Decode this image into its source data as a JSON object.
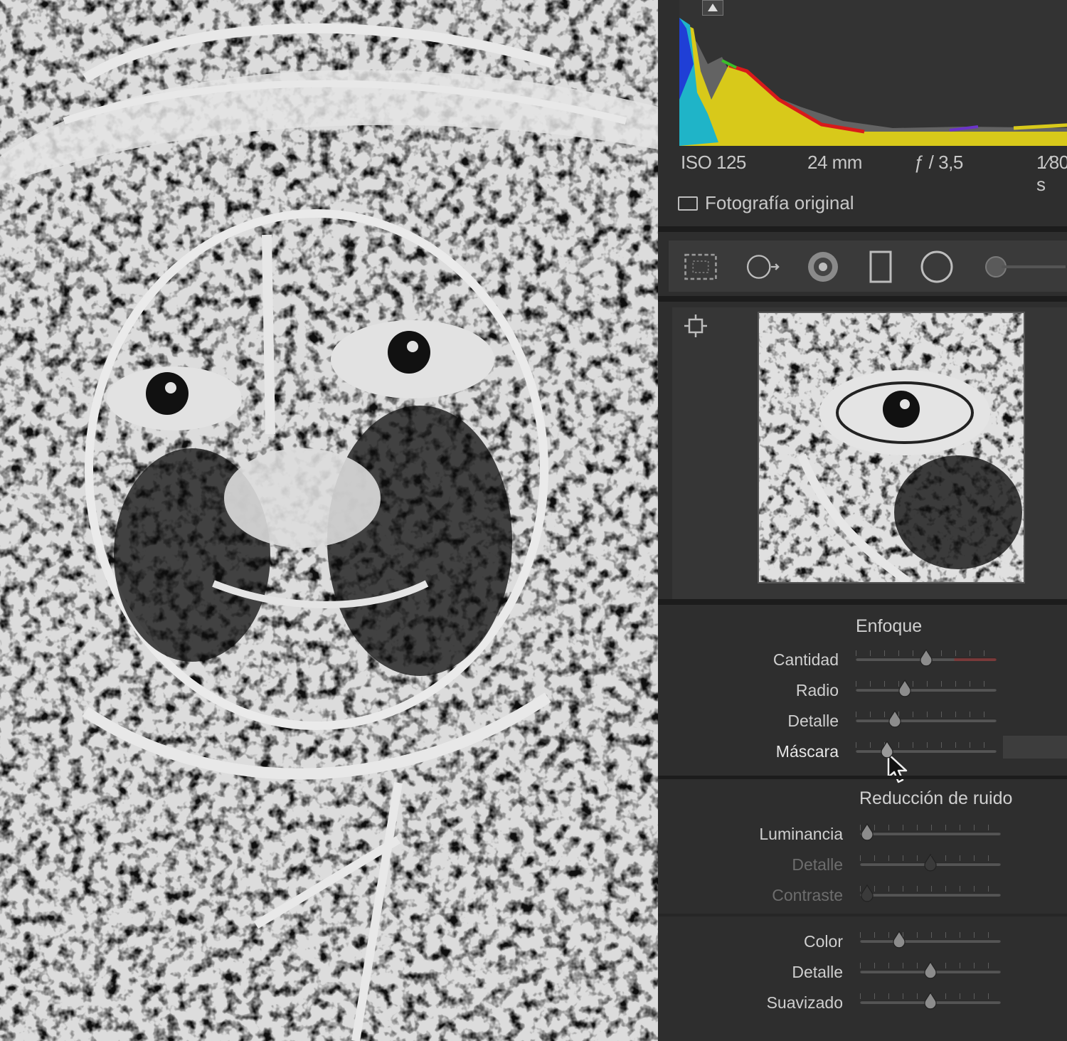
{
  "exif": {
    "iso": "ISO 125",
    "focal_length": "24 mm",
    "aperture": "ƒ / 3,5",
    "shutter": "1⁄80 s"
  },
  "original_photo_label": "Fotografía original",
  "tools": [
    {
      "name": "crop-overlay-icon"
    },
    {
      "name": "spot-removal-icon"
    },
    {
      "name": "red-eye-icon"
    },
    {
      "name": "graduated-filter-icon"
    },
    {
      "name": "radial-filter-icon"
    },
    {
      "name": "adjustment-brush-icon"
    }
  ],
  "sharpening": {
    "title": "Enfoque",
    "sliders": [
      {
        "label": "Cantidad",
        "value": 0.5,
        "state": "normal"
      },
      {
        "label": "Radio",
        "value": 0.35,
        "state": "normal"
      },
      {
        "label": "Detalle",
        "value": 0.28,
        "state": "normal"
      },
      {
        "label": "Máscara",
        "value": 0.22,
        "state": "active"
      }
    ]
  },
  "noise_reduction": {
    "title": "Reducción de ruido",
    "sliders": [
      {
        "label": "Luminancia",
        "value": 0.05,
        "state": "normal"
      },
      {
        "label": "Detalle",
        "value": 0.5,
        "state": "disabled"
      },
      {
        "label": "Contraste",
        "value": 0.05,
        "state": "disabled"
      },
      {
        "label": "Color",
        "value": 0.28,
        "state": "normal"
      },
      {
        "label": "Detalle",
        "value": 0.5,
        "state": "normal"
      },
      {
        "label": "Suavizado",
        "value": 0.5,
        "state": "normal"
      }
    ]
  },
  "colors": {
    "panel_bg": "#2e2e2e",
    "text": "#cfcfcf",
    "histogram_yellow": "#e6d81a",
    "histogram_red": "#d81a1a",
    "histogram_blue": "#1f3fd6",
    "histogram_cyan": "#19c7d8",
    "histogram_green": "#3bbf2a"
  }
}
